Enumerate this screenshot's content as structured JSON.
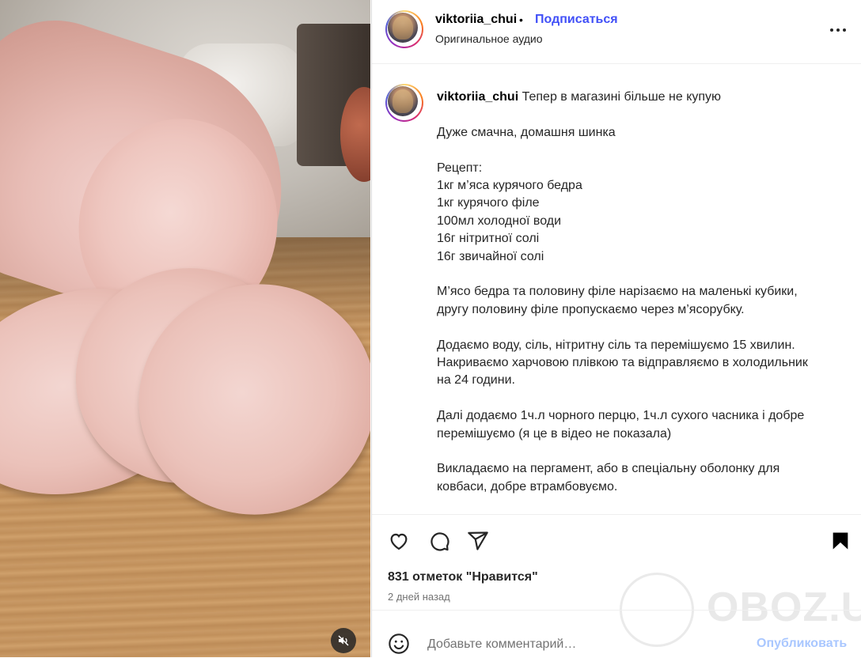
{
  "header": {
    "username": "viktoriia_chui",
    "separator": "•",
    "follow_label": "Подписаться",
    "audio_label": "Оригинальное аудио",
    "more_icon": "more-horizontal-icon"
  },
  "caption": {
    "username": "viktoriia_chui",
    "first_line": "Тепер в магазині більше не купую",
    "paragraphs": [
      [
        "Дуже смачна, домашня шинка"
      ],
      [
        "Рецепт:",
        "1кг м’яса курячого бедра",
        "1кг курячого філе",
        "100мл холодної води",
        "16г нітритної солі",
        "16г звичайної солі"
      ],
      [
        "М’ясо бедра та половину філе нарізаємо на маленькі кубики,",
        "другу половину філе пропускаємо через м’ясорубку."
      ],
      [
        "Додаємо воду, сіль, нітритну сіль та перемішуємо 15 хвилин.",
        "Накриваємо харчовою плівкою та відправляємо в холодильник",
        "на 24 години."
      ],
      [
        "Далі додаємо 1ч.л чорного перцю, 1ч.л сухого часника і добре",
        "перемішуємо (я це в відео не показала)"
      ],
      [
        "Викладаємо на пергамент, або в спеціальну оболонку для",
        "ковбаси, добре втрамбовуємо."
      ]
    ]
  },
  "actions": {
    "like_icon": "heart-icon",
    "comment_icon": "comment-icon",
    "share_icon": "share-icon",
    "save_icon": "bookmark-icon",
    "likes_text": "831 отметок \"Нравится\"",
    "time_text": "2 дней назад"
  },
  "watermark": {
    "text": "OBOZ.UA"
  },
  "comment": {
    "emoji_icon": "emoji-icon",
    "placeholder": "Добавьте комментарий…",
    "publish_label": "Опубликовать"
  },
  "media": {
    "mute_icon": "speaker-muted-icon"
  },
  "colors": {
    "accent": "#4150f7",
    "publish_disabled": "#a9c7ff",
    "text": "#262626",
    "muted": "#737373"
  }
}
